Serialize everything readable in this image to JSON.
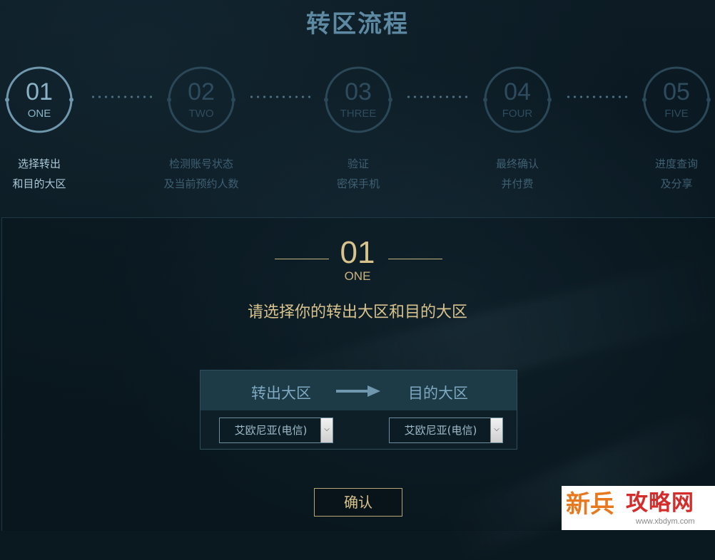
{
  "page_title": "转区流程",
  "steps": [
    {
      "num": "01",
      "word": "ONE",
      "label_line1": "选择转出",
      "label_line2": "和目的大区",
      "active": true
    },
    {
      "num": "02",
      "word": "TWO",
      "label_line1": "检测账号状态",
      "label_line2": "及当前预约人数",
      "active": false
    },
    {
      "num": "03",
      "word": "THREE",
      "label_line1": "验证",
      "label_line2": "密保手机",
      "active": false
    },
    {
      "num": "04",
      "word": "FOUR",
      "label_line1": "最终确认",
      "label_line2": "并付费",
      "active": false
    },
    {
      "num": "05",
      "word": "FIVE",
      "label_line1": "进度查询",
      "label_line2": "及分享",
      "active": false
    }
  ],
  "current_step": {
    "num": "01",
    "word": "ONE",
    "instruction": "请选择你的转出大区和目的大区"
  },
  "selector": {
    "from_label": "转出大区",
    "to_label": "目的大区",
    "from_value": "艾欧尼亚(电信)",
    "to_value": "艾欧尼亚(电信)"
  },
  "confirm_label": "确认",
  "watermark": {
    "char1": "新",
    "char2": "兵",
    "text": "攻略网",
    "url": "www.xbdym.com"
  },
  "colors": {
    "accent_gold": "#d8c38c",
    "accent_blue": "#8ab3c7",
    "inactive": "#2e4c5e"
  }
}
